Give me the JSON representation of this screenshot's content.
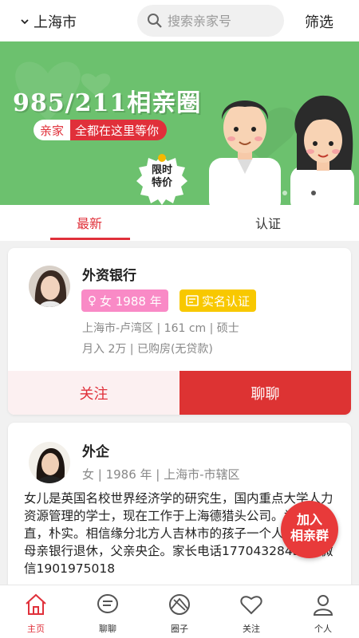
{
  "header": {
    "city": "上海市",
    "search_placeholder": "搜索亲家号",
    "filter_label": "筛选"
  },
  "banner": {
    "title": "985/211相亲圈",
    "sub_a": "亲家",
    "sub_b": "全都在这里等你",
    "badge": "限时\n特价",
    "accent_color": "#e0303a",
    "bg_color": "#6cc16e"
  },
  "tabs": [
    {
      "label": "最新",
      "active": true
    },
    {
      "label": "认证",
      "active": false
    }
  ],
  "cards": [
    {
      "name": "外资银行",
      "sex_tag": "女 1988 年",
      "verify_tag": "实名认证",
      "line1": "上海市-卢湾区 | 161 cm | 硕士",
      "line2": "月入 2万 | 已购房(无贷款)",
      "follow_label": "关注",
      "chat_label": "聊聊"
    },
    {
      "name": "外企",
      "line1": "女 | 1986 年 | 上海市-市辖区",
      "bio": "女儿是英国名校世界经济学的研究生，国内重点大学人力资源管理的学士，现在工作于上海德猎头公司。为人正直，朴实。相信缘分北方人吉林市的孩子一个人在上海。母亲银行退休，父亲央企。家长电话17704328439，微信1901975018"
    }
  ],
  "float_button": {
    "line1": "加入",
    "line2": "相亲群"
  },
  "bottom_nav": [
    {
      "label": "主页",
      "icon": "home-icon",
      "active": true
    },
    {
      "label": "聊聊",
      "icon": "chat-icon",
      "active": false
    },
    {
      "label": "圈子",
      "icon": "circle-icon",
      "active": false
    },
    {
      "label": "关注",
      "icon": "heart-icon",
      "active": false
    },
    {
      "label": "个人",
      "icon": "person-icon",
      "active": false
    }
  ]
}
